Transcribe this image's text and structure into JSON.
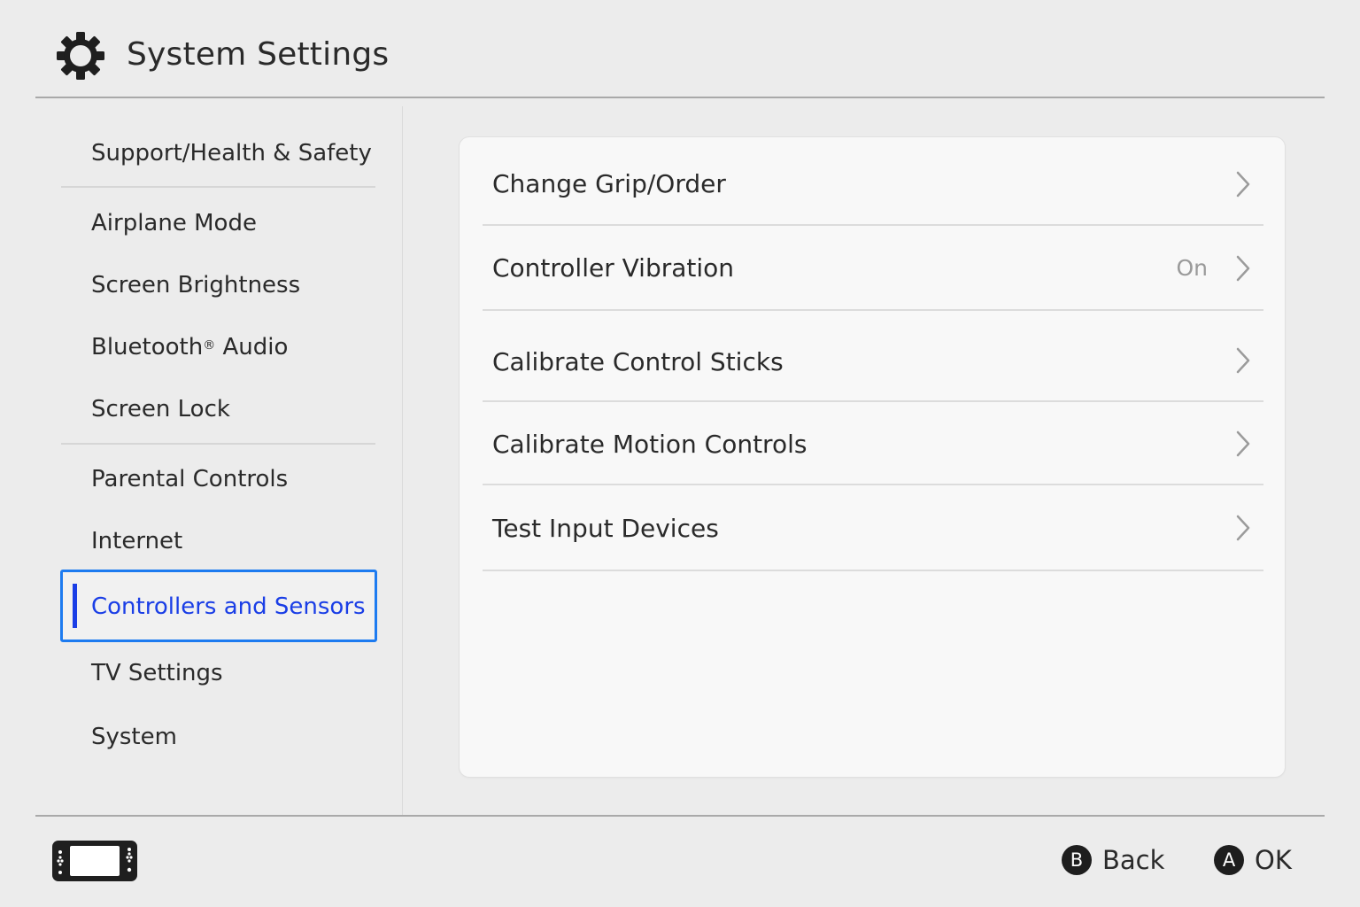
{
  "header": {
    "title": "System Settings",
    "icon": "gear-icon"
  },
  "sidebar": {
    "items": [
      {
        "label": "Support/Health & Safety"
      },
      {
        "label": "Airplane Mode"
      },
      {
        "label": "Screen Brightness"
      },
      {
        "label": "Bluetooth",
        "mark": "®",
        "suffix": " Audio"
      },
      {
        "label": "Screen Lock"
      },
      {
        "label": "Parental Controls"
      },
      {
        "label": "Internet"
      },
      {
        "label": "Controllers and Sensors",
        "selected": true
      },
      {
        "label": "TV Settings"
      },
      {
        "label": "System"
      }
    ],
    "selected_color": "#1a3ee6",
    "selection_border_color": "#1d7bf0"
  },
  "main": {
    "rows": [
      {
        "label": "Change Grip/Order",
        "value": ""
      },
      {
        "label": "Controller Vibration",
        "value": "On"
      },
      {
        "label": "Calibrate Control Sticks",
        "value": ""
      },
      {
        "label": "Calibrate Motion Controls",
        "value": ""
      },
      {
        "label": "Test Input Devices",
        "value": ""
      }
    ]
  },
  "footer": {
    "console_icon": "console-handheld-icon",
    "back": {
      "button": "B",
      "label": "Back"
    },
    "ok": {
      "button": "A",
      "label": "OK"
    }
  }
}
